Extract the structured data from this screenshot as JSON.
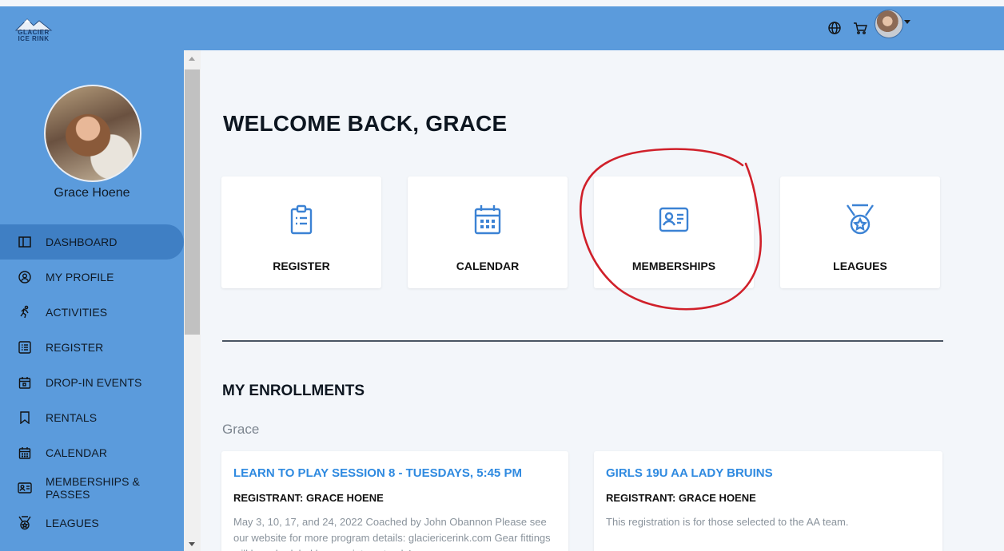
{
  "header": {
    "logo_text_top": "GLACIER",
    "logo_text_bottom": "ICE RINK",
    "icons": [
      "globe-icon",
      "cart-icon"
    ]
  },
  "sidebar": {
    "user_name": "Grace Hoene",
    "items": [
      {
        "label": "DASHBOARD",
        "icon": "dashboard-icon",
        "active": true
      },
      {
        "label": "MY PROFILE",
        "icon": "profile-icon",
        "active": false
      },
      {
        "label": "ACTIVITIES",
        "icon": "running-icon",
        "active": false
      },
      {
        "label": "REGISTER",
        "icon": "list-icon",
        "active": false
      },
      {
        "label": "DROP-IN EVENTS",
        "icon": "event-icon",
        "active": false
      },
      {
        "label": "RENTALS",
        "icon": "bookmark-icon",
        "active": false
      },
      {
        "label": "CALENDAR",
        "icon": "calendar-icon",
        "active": false
      },
      {
        "label": "MEMBERSHIPS & PASSES",
        "icon": "id-card-icon",
        "active": false
      },
      {
        "label": "LEAGUES",
        "icon": "medal-icon",
        "active": false
      }
    ]
  },
  "main": {
    "welcome": "WELCOME BACK, GRACE",
    "tiles": [
      {
        "label": "REGISTER",
        "icon": "clipboard-icon"
      },
      {
        "label": "CALENDAR",
        "icon": "calendar-icon"
      },
      {
        "label": "MEMBERSHIPS",
        "icon": "id-card-icon"
      },
      {
        "label": "LEAGUES",
        "icon": "medal-icon"
      }
    ],
    "enrollments_title": "MY ENROLLMENTS",
    "person": "Grace",
    "cards": [
      {
        "title": "LEARN TO PLAY SESSION 8 - TUESDAYS, 5:45 PM",
        "registrant": "REGISTRANT: GRACE HOENE",
        "description": "May 3, 10, 17, and 24, 2022  Coached by John Obannon  Please see our website for more program details: glaciericerink.com Gear fittings will be scheduled by appointment only!"
      },
      {
        "title": "GIRLS 19U AA LADY BRUINS",
        "registrant": "REGISTRANT: GRACE HOENE",
        "description": "This registration is for those selected to the AA team."
      }
    ]
  },
  "colors": {
    "header_bg": "#5b9bdc",
    "sidebar_active": "#3f7fc4",
    "accent_icon": "#3b82d4",
    "link": "#2f8ae0",
    "annotation": "#d0202a"
  }
}
